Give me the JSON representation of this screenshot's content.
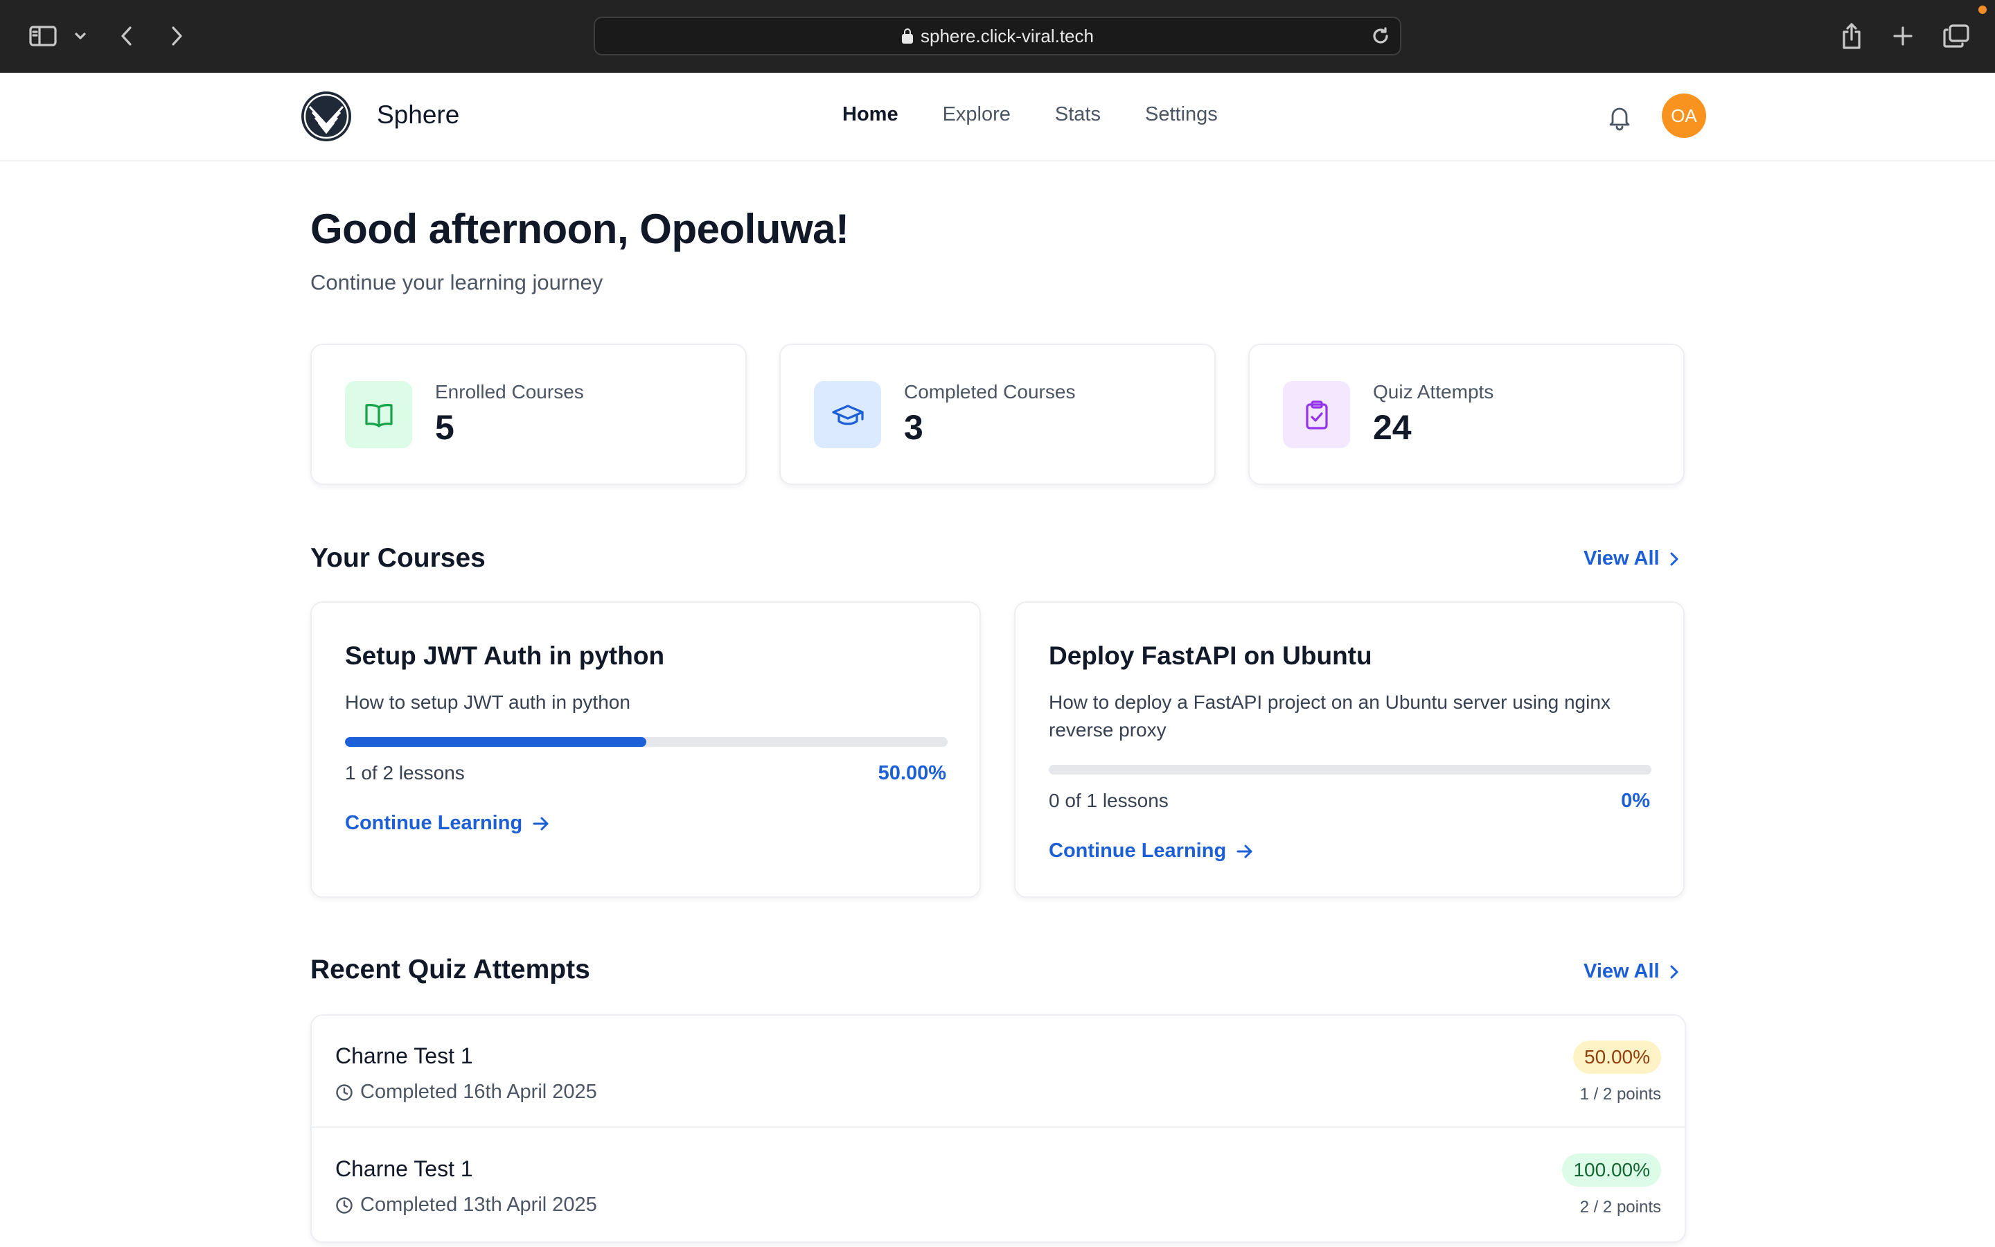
{
  "browser": {
    "url": "sphere.click-viral.tech"
  },
  "header": {
    "brand": "Sphere",
    "nav": [
      {
        "label": "Home",
        "active": true
      },
      {
        "label": "Explore",
        "active": false
      },
      {
        "label": "Stats",
        "active": false
      },
      {
        "label": "Settings",
        "active": false
      }
    ],
    "avatar_initials": "OA",
    "avatar_color": "#f7931e"
  },
  "main": {
    "greeting": "Good afternoon, Opeoluwa!",
    "subtitle": "Continue your learning journey",
    "stats": [
      {
        "label": "Enrolled Courses",
        "value": "5",
        "icon": "book-open-icon",
        "bg": "#dcfce7",
        "color": "#16a34a"
      },
      {
        "label": "Completed Courses",
        "value": "3",
        "icon": "graduation-cap-icon",
        "bg": "#dbeafe",
        "color": "#1d5fd6"
      },
      {
        "label": "Quiz Attempts",
        "value": "24",
        "icon": "clipboard-check-icon",
        "bg": "#f3e8ff",
        "color": "#9333ea"
      }
    ],
    "courses_section": {
      "title": "Your Courses",
      "view_all": "View All"
    },
    "courses": [
      {
        "title": "Setup JWT Auth in python",
        "description": "How to setup JWT auth in python",
        "progress": 0.5,
        "lessons": "1 of 2 lessons",
        "percent": "50.00%",
        "cta": "Continue Learning"
      },
      {
        "title": "Deploy FastAPI on Ubuntu",
        "description": "How to deploy a FastAPI project on an Ubuntu server using nginx reverse proxy",
        "progress": 0,
        "lessons": "0 of 1 lessons",
        "percent": "0%",
        "cta": "Continue Learning"
      }
    ],
    "quiz_section": {
      "title": "Recent Quiz Attempts",
      "view_all": "View All"
    },
    "quizzes": [
      {
        "title": "Charne Test 1",
        "date": "Completed 16th April 2025",
        "score": "50.00%",
        "points": "1 / 2 points",
        "badge_bg": "#fef3c7",
        "badge_color": "#92400e"
      },
      {
        "title": "Charne Test 1",
        "date": "Completed 13th April 2025",
        "score": "100.00%",
        "points": "2 / 2 points",
        "badge_bg": "#dcfce7",
        "badge_color": "#166534"
      }
    ]
  },
  "colors": {
    "accent": "#1d5fd6",
    "text": "#111827",
    "muted": "#4b5563"
  }
}
